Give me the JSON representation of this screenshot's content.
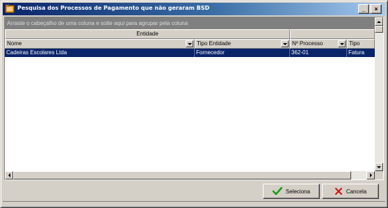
{
  "window": {
    "title": "Pesquisa dos Processos de Pagamento que não geraram BSD",
    "min_label": "_",
    "max_label": "□",
    "close_label": "×"
  },
  "grid": {
    "groupby_hint": "Arraste o cabeçalho de uma coluna e solte aqui para agrupar pela coluna",
    "band_label": "Entidade",
    "columns": [
      {
        "label": "Nome"
      },
      {
        "label": "Tipo Entidade"
      },
      {
        "label": "Nº Processo"
      },
      {
        "label": "Tipo"
      }
    ],
    "rows": [
      {
        "nome": "Cadeiras Escolares Ltda",
        "tipo_entidade": "Fornecedor",
        "n_processo": "362-01",
        "tipo": "Fatura"
      }
    ]
  },
  "buttons": {
    "seleciona": "Seleciona",
    "cancela": "Cancela"
  },
  "colors": {
    "title_start": "#0a246a",
    "title_end": "#a6caf0",
    "selection": "#0a246a",
    "groupby_bg": "#808080",
    "check": "#1a9a1a",
    "cancel_x": "#d01010"
  }
}
